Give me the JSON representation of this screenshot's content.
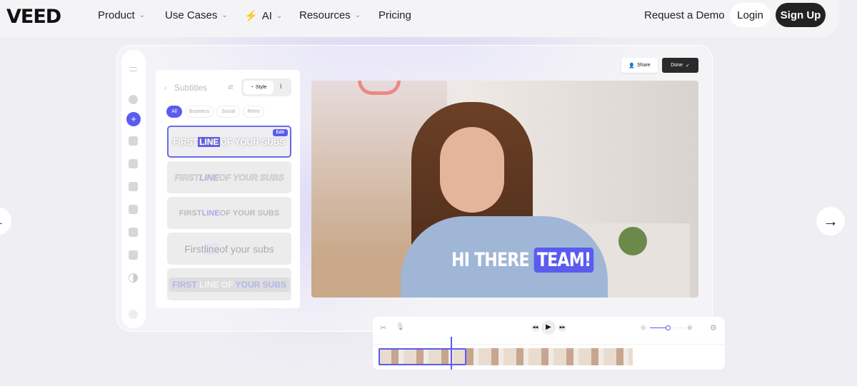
{
  "nav": {
    "logo": "VEED",
    "items": [
      {
        "label": "Product"
      },
      {
        "label": "Use Cases"
      },
      {
        "label": "AI"
      },
      {
        "label": "Resources"
      },
      {
        "label": "Pricing"
      }
    ],
    "demo": "Request a Demo",
    "login": "Login",
    "signup": "Sign Up"
  },
  "editor": {
    "share": "Share",
    "done": "Done",
    "panel": {
      "title": "Subtitles",
      "style": "Style",
      "chips": [
        "All",
        "Business",
        "Social",
        "Retro"
      ],
      "edit": "Edit",
      "presets": [
        {
          "a": "FIRST ",
          "b": "LINE",
          "c": " OF YOUR SUBS"
        },
        {
          "a": "FIRST ",
          "b": "LINE",
          "c": " OF YOUR SUBS"
        },
        {
          "a": "FIRST ",
          "b": "LINE",
          "c": " OF YOUR SUBS"
        },
        {
          "a": "First ",
          "b": "line",
          "c": " of your subs"
        },
        {
          "a": "FIRST ",
          "b": "LINE OF ",
          "c": "YOUR SUBS"
        }
      ]
    },
    "caption": {
      "a": "HI THERE ",
      "b": "TEAM!"
    },
    "accent": "#5b5bf0"
  }
}
